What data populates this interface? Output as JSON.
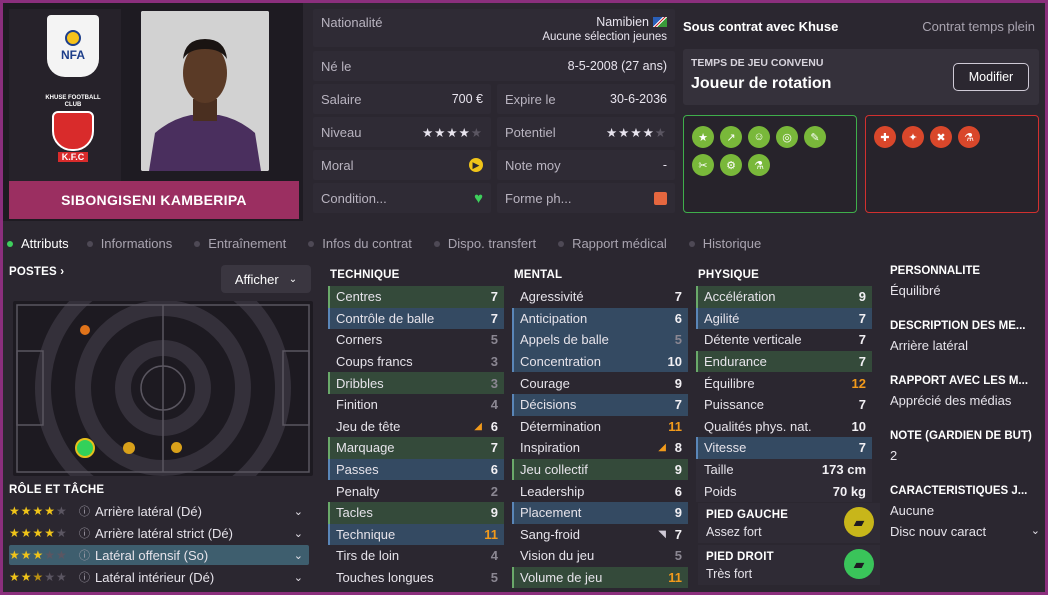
{
  "player": {
    "name": "SIBONGISENI KAMBERIPA"
  },
  "crests": {
    "nfa": "NFA",
    "club_top": "KHUSE FOOTBALL CLUB",
    "club_bottom": "K.F.C"
  },
  "info": {
    "nationality_label": "Nationalité",
    "nationality_value": "Namibien",
    "nationality_sub": "Aucune sélection jeunes",
    "born_label": "Né le",
    "born_value": "8-5-2008 (27 ans)",
    "salary_label": "Salaire",
    "salary_value": "700 €",
    "expires_label": "Expire le",
    "expires_value": "30-6-2036",
    "level_label": "Niveau",
    "potential_label": "Potentiel",
    "morale_label": "Moral",
    "rating_label": "Note moy",
    "rating_value": "-",
    "condition_label": "Condition...",
    "form_label": "Forme ph..."
  },
  "contract": {
    "status": "Sous contrat avec Khuse",
    "type": "Contrat temps plein",
    "playing_time_label": "TEMPS DE JEU CONVENU",
    "playing_time_value": "Joueur de rotation",
    "modify_button": "Modifier"
  },
  "tabs": [
    "Attributs",
    "Informations",
    "Entraînement",
    "Infos du contrat",
    "Dispo. transfert",
    "Rapport médical",
    "Historique"
  ],
  "positions": {
    "header": "POSTES",
    "display_button": "Afficher"
  },
  "roles": {
    "header": "RÔLE ET TÂCHE",
    "items": [
      {
        "label": "Arrière latéral (Dé)",
        "stars": 4
      },
      {
        "label": "Arrière latéral strict (Dé)",
        "stars": 4
      },
      {
        "label": "Latéral offensif (So)",
        "stars": 3
      },
      {
        "label": "Latéral intérieur (Dé)",
        "stars": 2.5
      }
    ]
  },
  "technique": {
    "header": "TECHNIQUE",
    "items": [
      [
        "Centres",
        "7"
      ],
      [
        "Contrôle de balle",
        "7"
      ],
      [
        "Corners",
        "5"
      ],
      [
        "Coups francs",
        "3"
      ],
      [
        "Dribbles",
        "3"
      ],
      [
        "Finition",
        "4"
      ],
      [
        "Jeu de tête",
        "6"
      ],
      [
        "Marquage",
        "7"
      ],
      [
        "Passes",
        "6"
      ],
      [
        "Penalty",
        "2"
      ],
      [
        "Tacles",
        "9"
      ],
      [
        "Technique",
        "11"
      ],
      [
        "Tirs de loin",
        "4"
      ],
      [
        "Touches longues",
        "5"
      ]
    ]
  },
  "mental": {
    "header": "MENTAL",
    "items": [
      [
        "Agressivité",
        "7"
      ],
      [
        "Anticipation",
        "6"
      ],
      [
        "Appels de balle",
        "5"
      ],
      [
        "Concentration",
        "10"
      ],
      [
        "Courage",
        "9"
      ],
      [
        "Décisions",
        "7"
      ],
      [
        "Détermination",
        "11"
      ],
      [
        "Inspiration",
        "8"
      ],
      [
        "Jeu collectif",
        "9"
      ],
      [
        "Leadership",
        "6"
      ],
      [
        "Placement",
        "9"
      ],
      [
        "Sang-froid",
        "7"
      ],
      [
        "Vision du jeu",
        "5"
      ],
      [
        "Volume de jeu",
        "11"
      ]
    ]
  },
  "physique": {
    "header": "PHYSIQUE",
    "items": [
      [
        "Accélération",
        "9"
      ],
      [
        "Agilité",
        "7"
      ],
      [
        "Détente verticale",
        "7"
      ],
      [
        "Endurance",
        "7"
      ],
      [
        "Équilibre",
        "12"
      ],
      [
        "Puissance",
        "7"
      ],
      [
        "Qualités phys. nat.",
        "10"
      ],
      [
        "Vitesse",
        "7"
      ],
      [
        "Taille",
        "173 cm"
      ],
      [
        "Poids",
        "70 kg"
      ]
    ],
    "left_foot_label": "PIED GAUCHE",
    "left_foot_value": "Assez fort",
    "right_foot_label": "PIED DROIT",
    "right_foot_value": "Très fort"
  },
  "side": {
    "personality_label": "PERSONNALITÉ",
    "personality_value": "Équilibré",
    "description_label": "DESCRIPTION DES MÉ...",
    "description_value": "Arrière latéral",
    "media_label": "RAPPORT AVEC LES M...",
    "media_value": "Apprécié des médias",
    "gk_label": "NOTE (GARDIEN DE BUT)",
    "gk_value": "2",
    "char_label": "CARACTÉRISTIQUES J...",
    "char_value": "Aucune",
    "disc_label": "Disc nouv caract"
  },
  "colors": {
    "accent": "#9b2f61",
    "good": "#3fae4b",
    "bad": "#d1302f",
    "highlight_orange": "#f29a1b"
  }
}
